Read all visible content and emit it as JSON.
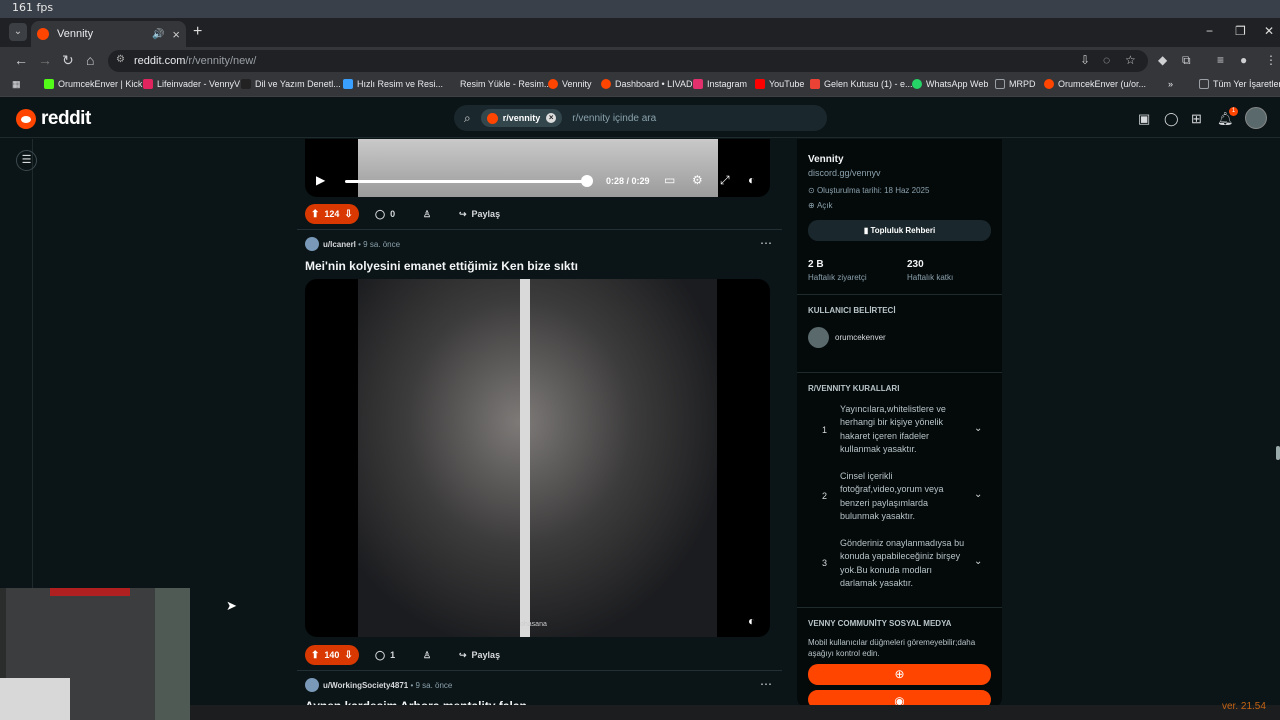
{
  "desktop": {
    "fps_text": "161 fps"
  },
  "browser": {
    "tab": {
      "title": "Vennity",
      "close": "×"
    },
    "new_tab": "+",
    "window_controls": {
      "minimize": "−",
      "restore": "❐",
      "close": "✕"
    },
    "url": {
      "host": "reddit.com",
      "path": "/r/vennity/new/"
    },
    "bookmarks": [
      {
        "label": "OrumcekEnver | Kick",
        "color": "#53fc18"
      },
      {
        "label": "Lifeinvader - VennyV",
        "color": "#e0245e"
      },
      {
        "label": "Dil ve Yazım Denetl...",
        "color": "#222222"
      },
      {
        "label": "Hızlı Resim ve Resi...",
        "color": "#3aa0ff"
      },
      {
        "label": "Resim Yükle - Resim...",
        "color": "#35363a"
      },
      {
        "label": "Vennity",
        "color": "#ff4500"
      },
      {
        "label": "Dashboard • LIVAD",
        "color": "#ff4500"
      },
      {
        "label": "Instagram",
        "color": "#e1306c"
      },
      {
        "label": "YouTube",
        "color": "#ff0000"
      },
      {
        "label": "Gelen Kutusu (1) - e...",
        "color": "#ea4335"
      },
      {
        "label": "WhatsApp Web",
        "color": "#25d366"
      },
      {
        "label": "MRPD",
        "color": "#9aa0a6"
      },
      {
        "label": "OrumcekEnver (u/or...",
        "color": "#ff4500"
      }
    ],
    "bookmarks_more": "»",
    "all_bookmarks": "Tüm Yer İşaretleri"
  },
  "reddit": {
    "logo_text": "reddit",
    "search": {
      "chip": "r/vennity",
      "placeholder": "r/vennity içinde ara"
    },
    "video_post": {
      "time": "0:28 / 0:29",
      "progress": 0.97,
      "votes": "124",
      "comments": "0",
      "share": "Paylaş"
    },
    "post2": {
      "author": "u/lcanerl",
      "age": "9 sa. önce",
      "title": "Mei'nin kolyesini emanet ettiğimiz Ken bize sıktı",
      "watermark": "ohasana",
      "votes": "140",
      "comments": "1",
      "share": "Paylaş"
    },
    "post3": {
      "author": "u/WorkingSociety4871",
      "age": "9 sa. önce",
      "title": "Aynen kardeşim Arbora mentality falan"
    },
    "sidebar": {
      "name": "Vennity",
      "link": "discord.gg/vennyv",
      "created": "Oluşturulma tarihi: 18 Haz 2025",
      "visibility": "Açık",
      "guide_button": "Topluluk Rehberi",
      "stat1_value": "2 B",
      "stat1_label": "Haftalık ziyaretçi",
      "stat2_value": "230",
      "stat2_label": "Haftalık katkı",
      "flair_heading": "KULLANICI BELİRTECİ",
      "flair_user": "orumcekenver",
      "rules_heading": "R/VENNITY KURALLARI",
      "rules": [
        {
          "n": "1",
          "text": "Yayıncılara,whitelistlere ve herhangi bir kişiye yönelik hakaret içeren ifadeler kullanmak yasaktır."
        },
        {
          "n": "2",
          "text": "Cinsel içerikli fotoğraf,video,yorum veya benzeri paylaşımlarda bulunmak yasaktır."
        },
        {
          "n": "3",
          "text": "Gönderiniz onaylanmadıysa bu konuda yapabileceğiniz birşey yok.Bu konuda modları darlamak yasaktır."
        }
      ],
      "social_heading": "VENNY COMMUNİTY SOSYAL MEDYA",
      "social_note": "Mobil kullanıcılar düğmeleri göremeyebilir;daha aşağıyı kontrol edin."
    },
    "notification_count": "1"
  },
  "overlay": {
    "version": "ver. 21.54"
  }
}
